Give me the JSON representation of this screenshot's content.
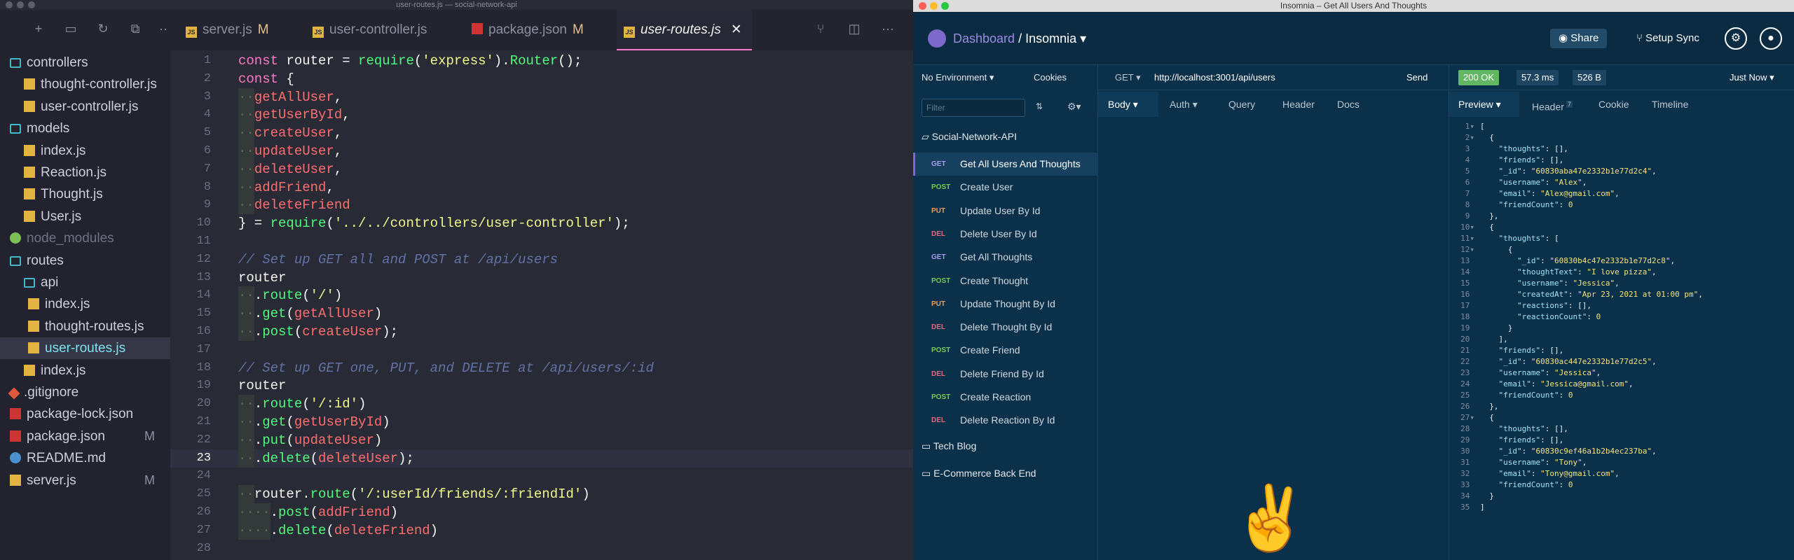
{
  "vscode": {
    "title": "user-routes.js — social-network-api",
    "tabs": [
      {
        "name": "server.js",
        "mod": "M"
      },
      {
        "name": "user-controller.js",
        "mod": ""
      },
      {
        "name": "package.json",
        "mod": "M"
      },
      {
        "name": "user-routes.js",
        "mod": ""
      }
    ],
    "tree": [
      {
        "label": "controllers",
        "kind": "folder",
        "badge": ""
      },
      {
        "label": "thought-controller.js",
        "kind": "js",
        "badge": ""
      },
      {
        "label": "user-controller.js",
        "kind": "js",
        "badge": ""
      },
      {
        "label": "models",
        "kind": "folder",
        "badge": ""
      },
      {
        "label": "index.js",
        "kind": "js",
        "badge": ""
      },
      {
        "label": "Reaction.js",
        "kind": "js",
        "badge": ""
      },
      {
        "label": "Thought.js",
        "kind": "js",
        "badge": ""
      },
      {
        "label": "User.js",
        "kind": "js",
        "badge": ""
      },
      {
        "label": "node_modules",
        "kind": "node",
        "badge": ""
      },
      {
        "label": "routes",
        "kind": "folder",
        "badge": ""
      },
      {
        "label": "api",
        "kind": "folder",
        "badge": ""
      },
      {
        "label": "index.js",
        "kind": "js",
        "badge": ""
      },
      {
        "label": "thought-routes.js",
        "kind": "js",
        "badge": ""
      },
      {
        "label": "user-routes.js",
        "kind": "js",
        "badge": ""
      },
      {
        "label": "index.js",
        "kind": "js",
        "badge": ""
      },
      {
        "label": ".gitignore",
        "kind": "git",
        "badge": ""
      },
      {
        "label": "package-lock.json",
        "kind": "npm",
        "badge": ""
      },
      {
        "label": "package.json",
        "kind": "npm",
        "badge": "M"
      },
      {
        "label": "README.md",
        "kind": "info",
        "badge": ""
      },
      {
        "label": "server.js",
        "kind": "js",
        "badge": "M"
      }
    ],
    "code": [
      "const router = require('express').Router();",
      "const {",
      "  getAllUser,",
      "  getUserById,",
      "  createUser,",
      "  updateUser,",
      "  deleteUser,",
      "  addFriend,",
      "  deleteFriend",
      "} = require('../../controllers/user-controller');",
      "",
      "// Set up GET all and POST at /api/users",
      "router",
      "  .route('/')",
      "  .get(getAllUser)",
      "  .post(createUser);",
      "",
      "// Set up GET one, PUT, and DELETE at /api/users/:id",
      "router",
      "  .route('/:id')",
      "  .get(getUserById)",
      "  .put(updateUser)",
      "  .delete(deleteUser);",
      "",
      "  router.route('/:userId/friends/:friendId')",
      "    .post(addFriend)",
      "    .delete(deleteFriend)",
      ""
    ],
    "current_line": 23
  },
  "insomnia": {
    "title": "Insomnia – Get All Users And Thoughts",
    "crumb_dashboard": "Dashboard",
    "crumb_sep": " / ",
    "crumb_app": "Insomnia",
    "share": "Share",
    "setup_sync": "Setup Sync",
    "environment": "No Environment",
    "cookies": "Cookies",
    "filter_placeholder": "Filter",
    "method": "GET",
    "url": "http://localhost:3001/api/users",
    "send": "Send",
    "status": "200 OK",
    "time": "57.3 ms",
    "size": "526 B",
    "when": "Just Now",
    "req_tabs": [
      "Body",
      "Auth",
      "Query",
      "Header",
      "Docs"
    ],
    "resp_tabs": [
      "Preview",
      "Header",
      "Cookie",
      "Timeline"
    ],
    "header_count": "7",
    "collection": "Social-Network-API",
    "requests": [
      {
        "method": "GET",
        "name": "Get All Users And Thoughts",
        "selected": true
      },
      {
        "method": "POST",
        "name": "Create User"
      },
      {
        "method": "PUT",
        "name": "Update User By Id"
      },
      {
        "method": "DEL",
        "name": "Delete User By Id"
      },
      {
        "method": "GET",
        "name": "Get All Thoughts"
      },
      {
        "method": "POST",
        "name": "Create Thought"
      },
      {
        "method": "PUT",
        "name": "Update Thought By Id"
      },
      {
        "method": "DEL",
        "name": "Delete Thought By Id"
      },
      {
        "method": "POST",
        "name": "Create Friend"
      },
      {
        "method": "DEL",
        "name": "Delete Friend By Id"
      },
      {
        "method": "POST",
        "name": "Create Reaction"
      },
      {
        "method": "DEL",
        "name": "Delete Reaction By Id"
      }
    ],
    "folders": [
      "Tech Blog",
      "E-Commerce Back End"
    ],
    "response": [
      "[",
      "  {",
      "    \"thoughts\": [],",
      "    \"friends\": [],",
      "    \"_id\": \"60830aba47e2332b1e77d2c4\",",
      "    \"username\": \"Alex\",",
      "    \"email\": \"Alex@gmail.com\",",
      "    \"friendCount\": 0",
      "  },",
      "  {",
      "    \"thoughts\": [",
      "      {",
      "        \"_id\": \"60830b4c47e2332b1e77d2c8\",",
      "        \"thoughtText\": \"I love pizza\",",
      "        \"username\": \"Jessica\",",
      "        \"createdAt\": \"Apr 23, 2021 at 01:00 pm\",",
      "        \"reactions\": [],",
      "        \"reactionCount\": 0",
      "      }",
      "    ],",
      "    \"friends\": [],",
      "    \"_id\": \"60830ac447e2332b1e77d2c5\",",
      "    \"username\": \"Jessica\",",
      "    \"email\": \"Jessica@gmail.com\",",
      "    \"friendCount\": 0",
      "  },",
      "  {",
      "    \"thoughts\": [],",
      "    \"friends\": [],",
      "    \"_id\": \"60830c9ef46a1b2b4ec237ba\",",
      "    \"username\": \"Tony\",",
      "    \"email\": \"Tony@gmail.com\",",
      "    \"friendCount\": 0",
      "  }",
      "]"
    ]
  }
}
